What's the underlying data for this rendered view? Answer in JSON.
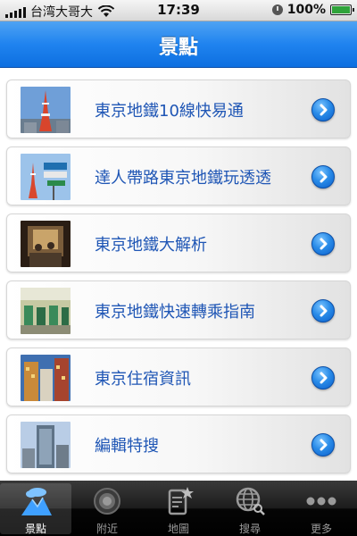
{
  "status_bar": {
    "carrier": "台湾大哥大",
    "time": "17:39",
    "battery": "100%"
  },
  "nav": {
    "title": "景點"
  },
  "list": {
    "items": [
      {
        "label": "東京地鐵10線快易通",
        "thumb": "tokyo-tower-photo"
      },
      {
        "label": "達人帶路東京地鐵玩透透",
        "thumb": "tower-and-signs-photo"
      },
      {
        "label": "東京地鐵大解析",
        "thumb": "subway-car-interior-photo"
      },
      {
        "label": "東京地鐵快速轉乘指南",
        "thumb": "station-gates-photo"
      },
      {
        "label": "東京住宿資訊",
        "thumb": "hotel-building-photo"
      },
      {
        "label": "編輯特搜",
        "thumb": "skyscraper-photo"
      }
    ]
  },
  "tabbar": {
    "tabs": [
      {
        "label": "景點",
        "icon": "landscape-cloud-icon",
        "active": true
      },
      {
        "label": "附近",
        "icon": "radar-circle-icon",
        "active": false
      },
      {
        "label": "地圖",
        "icon": "map-star-icon",
        "active": false
      },
      {
        "label": "搜尋",
        "icon": "globe-search-icon",
        "active": false
      },
      {
        "label": "更多",
        "icon": "more-dots-icon",
        "active": false
      }
    ]
  },
  "colors": {
    "nav_blue": "#1f83ef",
    "label_blue": "#1f56b5",
    "tab_active_label": "#ffffff",
    "tab_inactive_label": "#9a9a9a"
  }
}
